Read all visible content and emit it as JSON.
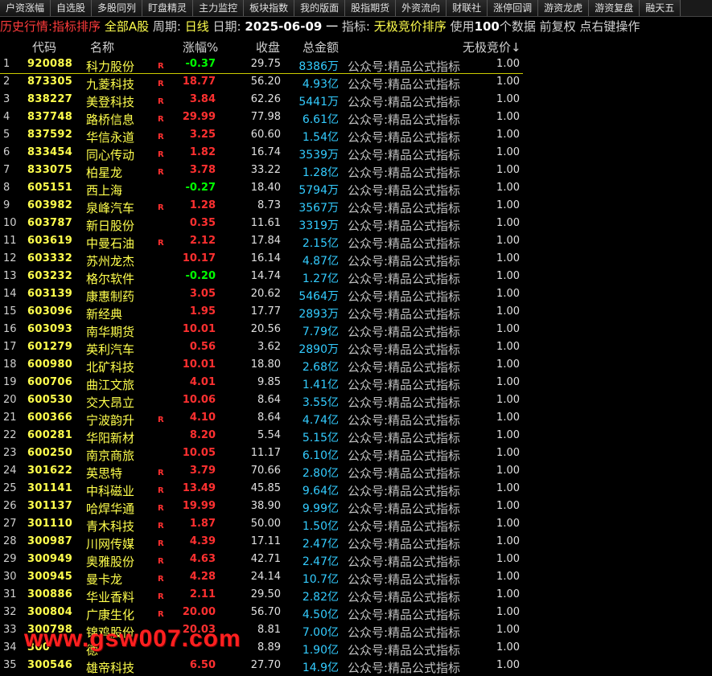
{
  "topnav": [
    "户资涨幅",
    "自选股",
    "多股同列",
    "盯盘精灵",
    "主力监控",
    "板块指数",
    "我的版面",
    "股指期货",
    "外资流向",
    "财联社",
    "涨停回调",
    "游资龙虎",
    "游资复盘",
    "融天五"
  ],
  "infobar": {
    "prefix": "历史行情:指标排序",
    "market": "全部A股",
    "period_label": "周期:",
    "period_value": "日线",
    "date_label": "日期:",
    "date_value": "2025-06-09",
    "dash": "一",
    "indicator_label": "指标:",
    "indicator_value": "无极竞价排序",
    "use_label": "使用",
    "data_count": "100",
    "data_suffix": "个数据 前复权 点右键操作"
  },
  "columns": {
    "code": "代码",
    "name": "名称",
    "change": "涨幅%",
    "close": "收盘",
    "amount": "总金额",
    "indicator": "无极竞价",
    "sort_arrow": "↓"
  },
  "rows": [
    {
      "idx": "1",
      "code": "920088",
      "name": "科力股份",
      "r": "R",
      "chg": "-0.37",
      "close": "29.75",
      "amt": "8386万",
      "ind": "公众号:精品公式指标",
      "val": "1.00",
      "dir": "down"
    },
    {
      "idx": "2",
      "code": "873305",
      "name": "九菱科技",
      "r": "R",
      "chg": "18.77",
      "close": "56.20",
      "amt": "4.93亿",
      "ind": "公众号:精品公式指标",
      "val": "1.00",
      "dir": "up"
    },
    {
      "idx": "3",
      "code": "838227",
      "name": "美登科技",
      "r": "R",
      "chg": "3.84",
      "close": "62.26",
      "amt": "5441万",
      "ind": "公众号:精品公式指标",
      "val": "1.00",
      "dir": "up"
    },
    {
      "idx": "4",
      "code": "837748",
      "name": "路桥信息",
      "r": "R",
      "chg": "29.99",
      "close": "77.98",
      "amt": "6.61亿",
      "ind": "公众号:精品公式指标",
      "val": "1.00",
      "dir": "up"
    },
    {
      "idx": "5",
      "code": "837592",
      "name": "华信永道",
      "r": "R",
      "chg": "3.25",
      "close": "60.60",
      "amt": "1.54亿",
      "ind": "公众号:精品公式指标",
      "val": "1.00",
      "dir": "up"
    },
    {
      "idx": "6",
      "code": "833454",
      "name": "同心传动",
      "r": "R",
      "chg": "1.82",
      "close": "16.74",
      "amt": "3539万",
      "ind": "公众号:精品公式指标",
      "val": "1.00",
      "dir": "up"
    },
    {
      "idx": "7",
      "code": "833075",
      "name": "柏星龙",
      "r": "R",
      "chg": "3.78",
      "close": "33.22",
      "amt": "1.28亿",
      "ind": "公众号:精品公式指标",
      "val": "1.00",
      "dir": "up"
    },
    {
      "idx": "8",
      "code": "605151",
      "name": "西上海",
      "r": "",
      "chg": "-0.27",
      "close": "18.40",
      "amt": "5794万",
      "ind": "公众号:精品公式指标",
      "val": "1.00",
      "dir": "down"
    },
    {
      "idx": "9",
      "code": "603982",
      "name": "泉峰汽车",
      "r": "R",
      "chg": "1.28",
      "close": "8.73",
      "amt": "3567万",
      "ind": "公众号:精品公式指标",
      "val": "1.00",
      "dir": "up"
    },
    {
      "idx": "10",
      "code": "603787",
      "name": "新日股份",
      "r": "",
      "chg": "0.35",
      "close": "11.61",
      "amt": "3319万",
      "ind": "公众号:精品公式指标",
      "val": "1.00",
      "dir": "up"
    },
    {
      "idx": "11",
      "code": "603619",
      "name": "中曼石油",
      "r": "R",
      "chg": "2.12",
      "close": "17.84",
      "amt": "2.15亿",
      "ind": "公众号:精品公式指标",
      "val": "1.00",
      "dir": "up"
    },
    {
      "idx": "12",
      "code": "603332",
      "name": "苏州龙杰",
      "r": "",
      "chg": "10.17",
      "close": "16.14",
      "amt": "4.87亿",
      "ind": "公众号:精品公式指标",
      "val": "1.00",
      "dir": "up"
    },
    {
      "idx": "13",
      "code": "603232",
      "name": "格尔软件",
      "r": "",
      "chg": "-0.20",
      "close": "14.74",
      "amt": "1.27亿",
      "ind": "公众号:精品公式指标",
      "val": "1.00",
      "dir": "down"
    },
    {
      "idx": "14",
      "code": "603139",
      "name": "康惠制药",
      "r": "",
      "chg": "3.05",
      "close": "20.62",
      "amt": "5464万",
      "ind": "公众号:精品公式指标",
      "val": "1.00",
      "dir": "up"
    },
    {
      "idx": "15",
      "code": "603096",
      "name": "新经典",
      "r": "",
      "chg": "1.95",
      "close": "17.77",
      "amt": "2893万",
      "ind": "公众号:精品公式指标",
      "val": "1.00",
      "dir": "up"
    },
    {
      "idx": "16",
      "code": "603093",
      "name": "南华期货",
      "r": "",
      "chg": "10.01",
      "close": "20.56",
      "amt": "7.79亿",
      "ind": "公众号:精品公式指标",
      "val": "1.00",
      "dir": "up"
    },
    {
      "idx": "17",
      "code": "601279",
      "name": "英利汽车",
      "r": "",
      "chg": "0.56",
      "close": "3.62",
      "amt": "2890万",
      "ind": "公众号:精品公式指标",
      "val": "1.00",
      "dir": "up"
    },
    {
      "idx": "18",
      "code": "600980",
      "name": "北矿科技",
      "r": "",
      "chg": "10.01",
      "close": "18.80",
      "amt": "2.68亿",
      "ind": "公众号:精品公式指标",
      "val": "1.00",
      "dir": "up"
    },
    {
      "idx": "19",
      "code": "600706",
      "name": "曲江文旅",
      "r": "",
      "chg": "4.01",
      "close": "9.85",
      "amt": "1.41亿",
      "ind": "公众号:精品公式指标",
      "val": "1.00",
      "dir": "up"
    },
    {
      "idx": "20",
      "code": "600530",
      "name": "交大昂立",
      "r": "",
      "chg": "10.06",
      "close": "8.64",
      "amt": "3.55亿",
      "ind": "公众号:精品公式指标",
      "val": "1.00",
      "dir": "up"
    },
    {
      "idx": "21",
      "code": "600366",
      "name": "宁波韵升",
      "r": "R",
      "chg": "4.10",
      "close": "8.64",
      "amt": "4.74亿",
      "ind": "公众号:精品公式指标",
      "val": "1.00",
      "dir": "up"
    },
    {
      "idx": "22",
      "code": "600281",
      "name": "华阳新材",
      "r": "",
      "chg": "8.20",
      "close": "5.54",
      "amt": "5.15亿",
      "ind": "公众号:精品公式指标",
      "val": "1.00",
      "dir": "up"
    },
    {
      "idx": "23",
      "code": "600250",
      "name": "南京商旅",
      "r": "",
      "chg": "10.05",
      "close": "11.17",
      "amt": "6.10亿",
      "ind": "公众号:精品公式指标",
      "val": "1.00",
      "dir": "up"
    },
    {
      "idx": "24",
      "code": "301622",
      "name": "英思特",
      "r": "R",
      "chg": "3.79",
      "close": "70.66",
      "amt": "2.80亿",
      "ind": "公众号:精品公式指标",
      "val": "1.00",
      "dir": "up"
    },
    {
      "idx": "25",
      "code": "301141",
      "name": "中科磁业",
      "r": "R",
      "chg": "13.49",
      "close": "45.85",
      "amt": "9.64亿",
      "ind": "公众号:精品公式指标",
      "val": "1.00",
      "dir": "up"
    },
    {
      "idx": "26",
      "code": "301137",
      "name": "哈焊华通",
      "r": "R",
      "chg": "19.99",
      "close": "38.90",
      "amt": "9.99亿",
      "ind": "公众号:精品公式指标",
      "val": "1.00",
      "dir": "up"
    },
    {
      "idx": "27",
      "code": "301110",
      "name": "青木科技",
      "r": "R",
      "chg": "1.87",
      "close": "50.00",
      "amt": "1.50亿",
      "ind": "公众号:精品公式指标",
      "val": "1.00",
      "dir": "up"
    },
    {
      "idx": "28",
      "code": "300987",
      "name": "川网传媒",
      "r": "R",
      "chg": "4.39",
      "close": "17.11",
      "amt": "2.47亿",
      "ind": "公众号:精品公式指标",
      "val": "1.00",
      "dir": "up"
    },
    {
      "idx": "29",
      "code": "300949",
      "name": "奥雅股份",
      "r": "R",
      "chg": "4.63",
      "close": "42.71",
      "amt": "2.47亿",
      "ind": "公众号:精品公式指标",
      "val": "1.00",
      "dir": "up"
    },
    {
      "idx": "30",
      "code": "300945",
      "name": "曼卡龙",
      "r": "R",
      "chg": "4.28",
      "close": "24.14",
      "amt": "10.7亿",
      "ind": "公众号:精品公式指标",
      "val": "1.00",
      "dir": "up"
    },
    {
      "idx": "31",
      "code": "300886",
      "name": "华业香料",
      "r": "R",
      "chg": "2.11",
      "close": "29.50",
      "amt": "2.82亿",
      "ind": "公众号:精品公式指标",
      "val": "1.00",
      "dir": "up"
    },
    {
      "idx": "32",
      "code": "300804",
      "name": "广康生化",
      "r": "R",
      "chg": "20.00",
      "close": "56.70",
      "amt": "4.50亿",
      "ind": "公众号:精品公式指标",
      "val": "1.00",
      "dir": "up"
    },
    {
      "idx": "33",
      "code": "300798",
      "name": "锦鸡股份",
      "r": "",
      "chg": "20.03",
      "close": "8.81",
      "amt": "7.00亿",
      "ind": "公众号:精品公式指标",
      "val": "1.00",
      "dir": "up"
    },
    {
      "idx": "34",
      "code": "300",
      "name": "德",
      "r": "",
      "chg": "",
      "close": "8.89",
      "amt": "1.90亿",
      "ind": "公众号:精品公式指标",
      "val": "1.00",
      "dir": "up"
    },
    {
      "idx": "35",
      "code": "300546",
      "name": "雄帝科技",
      "r": "",
      "chg": "6.50",
      "close": "27.70",
      "amt": "14.9亿",
      "ind": "公众号:精品公式指标",
      "val": "1.00",
      "dir": "up"
    }
  ],
  "watermark": "www.gsw007.com"
}
